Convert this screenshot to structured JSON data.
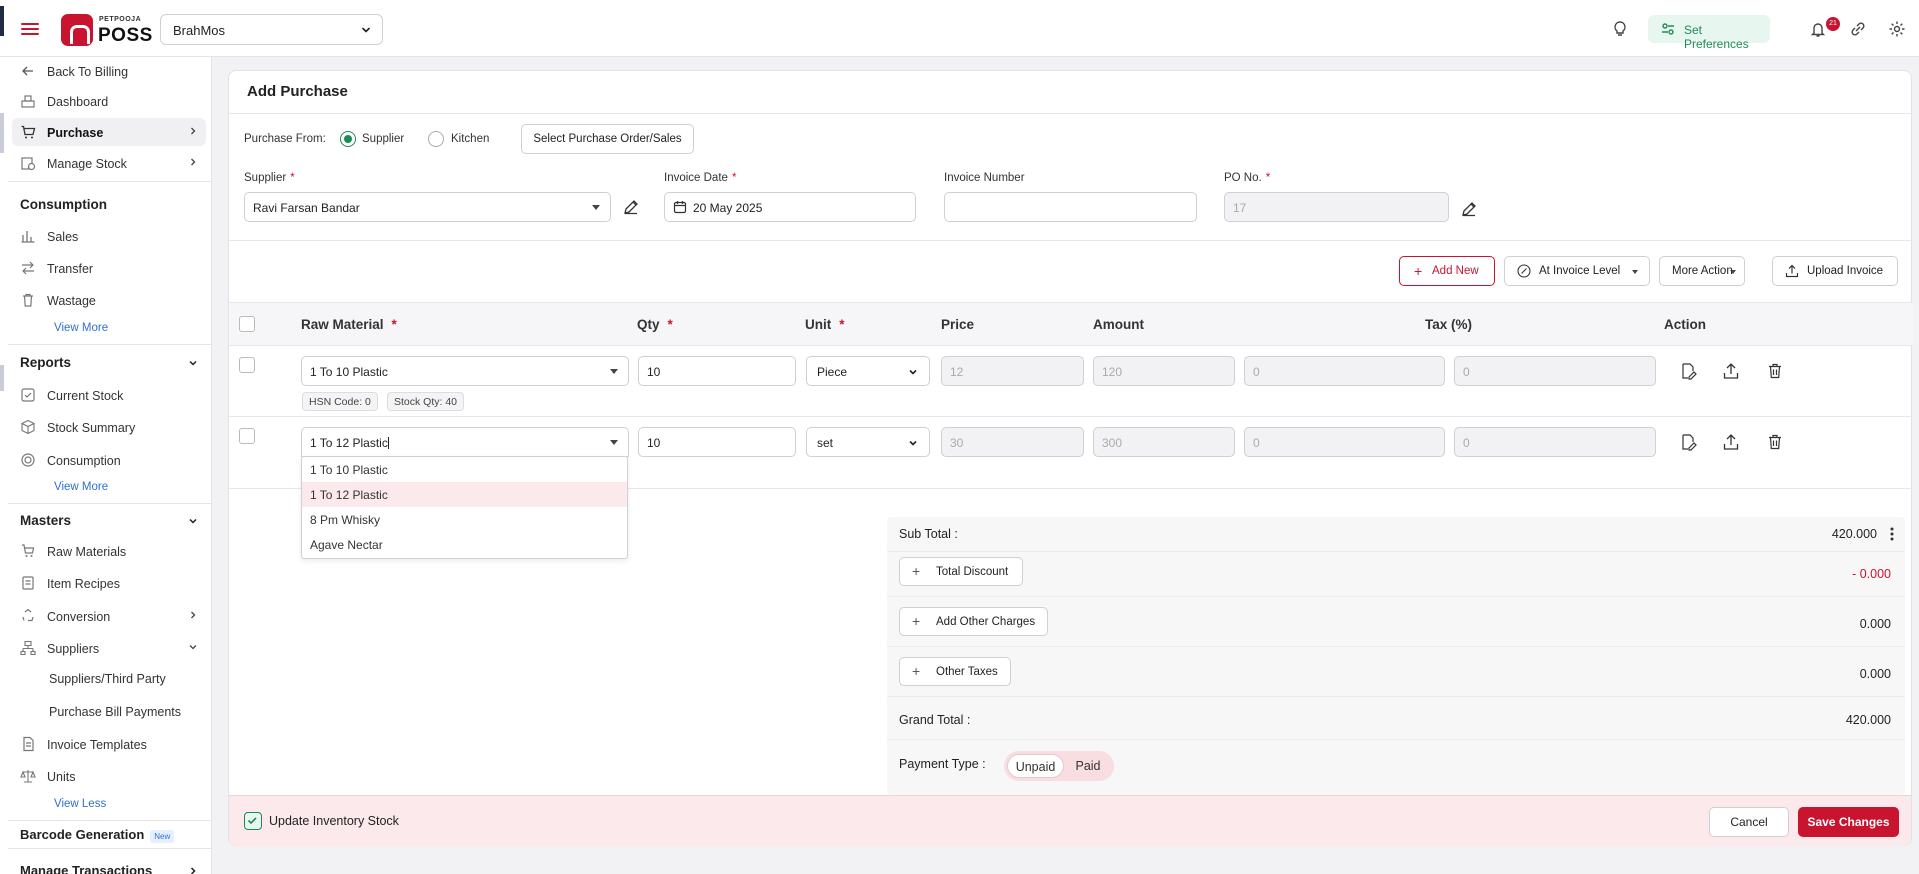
{
  "colors": {
    "brand": "#c8142f",
    "success": "#1e8a55",
    "link": "#2f6fd6"
  },
  "header": {
    "logo_small": "PETPOOJA",
    "logo_big": "POSS",
    "outlet": "BrahMos",
    "preferences_label": "Set Preferences",
    "notification_count": "21"
  },
  "sidebar": {
    "back": "Back To Billing",
    "dashboard": "Dashboard",
    "purchase": "Purchase",
    "manage_stock": "Manage Stock",
    "consumption_head": "Consumption",
    "sales": "Sales",
    "transfer": "Transfer",
    "wastage": "Wastage",
    "view_more_1": "View More",
    "reports_head": "Reports",
    "current_stock": "Current Stock",
    "stock_summary": "Stock Summary",
    "consumption": "Consumption",
    "view_more_2": "View More",
    "masters_head": "Masters",
    "raw_materials": "Raw Materials",
    "item_recipes": "Item Recipes",
    "conversion": "Conversion",
    "suppliers": "Suppliers",
    "suppliers_third_party": "Suppliers/Third Party",
    "purchase_bill_payments": "Purchase Bill Payments",
    "invoice_templates": "Invoice Templates",
    "units": "Units",
    "view_less": "View Less",
    "barcode": "Barcode Generation",
    "barcode_badge": "New",
    "manage_transactions": "Manage Transactions"
  },
  "form": {
    "title": "Add Purchase",
    "purchase_from_label": "Purchase From:",
    "opt_supplier": "Supplier",
    "opt_kitchen": "Kitchen",
    "select_po_button": "Select Purchase Order/Sales",
    "supplier_label": "Supplier",
    "supplier_value": "Ravi Farsan Bandar",
    "invoice_date_label": "Invoice Date",
    "invoice_date_value": "20 May 2025",
    "invoice_number_label": "Invoice Number",
    "invoice_number_value": "",
    "po_label": "PO No.",
    "po_value": "17",
    "required_mark": "*"
  },
  "toolbar": {
    "add_new": "Add New",
    "invoice_level": "At Invoice Level",
    "more_action": "More Action",
    "upload_invoice": "Upload Invoice"
  },
  "table": {
    "headers": {
      "raw_material": "Raw Material",
      "qty": "Qty",
      "unit": "Unit",
      "price": "Price",
      "amount": "Amount",
      "tax": "Tax (%)",
      "action": "Action"
    },
    "rows": [
      {
        "material": "1 To 10 Plastic",
        "qty": "10",
        "unit": "Piece",
        "price": "12",
        "amount": "120",
        "discount": "0",
        "tax": "0",
        "hsn": "HSN Code: 0",
        "stock": "Stock Qty: 40"
      },
      {
        "material": "1 To 12 Plastic",
        "qty": "10",
        "unit": "set",
        "price": "30",
        "amount": "300",
        "discount": "0",
        "tax": "0"
      }
    ],
    "dropdown_options": [
      "1 To 10 Plastic",
      "1 To 12 Plastic",
      "8 Pm Whisky",
      "Agave Nectar"
    ]
  },
  "totals": {
    "sub_total_label": "Sub Total :",
    "sub_total_value": "420.000",
    "total_discount_button": "Total Discount",
    "discount_value": "- 0.000",
    "other_charges_button": "Add Other Charges",
    "other_charges_value": "0.000",
    "other_taxes_button": "Other Taxes",
    "other_taxes_value": "0.000",
    "grand_total_label": "Grand Total :",
    "grand_total_value": "420.000",
    "payment_type_label": "Payment Type :",
    "payment_unpaid": "Unpaid",
    "payment_paid": "Paid"
  },
  "footer": {
    "update_inventory": "Update Inventory Stock",
    "cancel": "Cancel",
    "save": "Save Changes"
  }
}
